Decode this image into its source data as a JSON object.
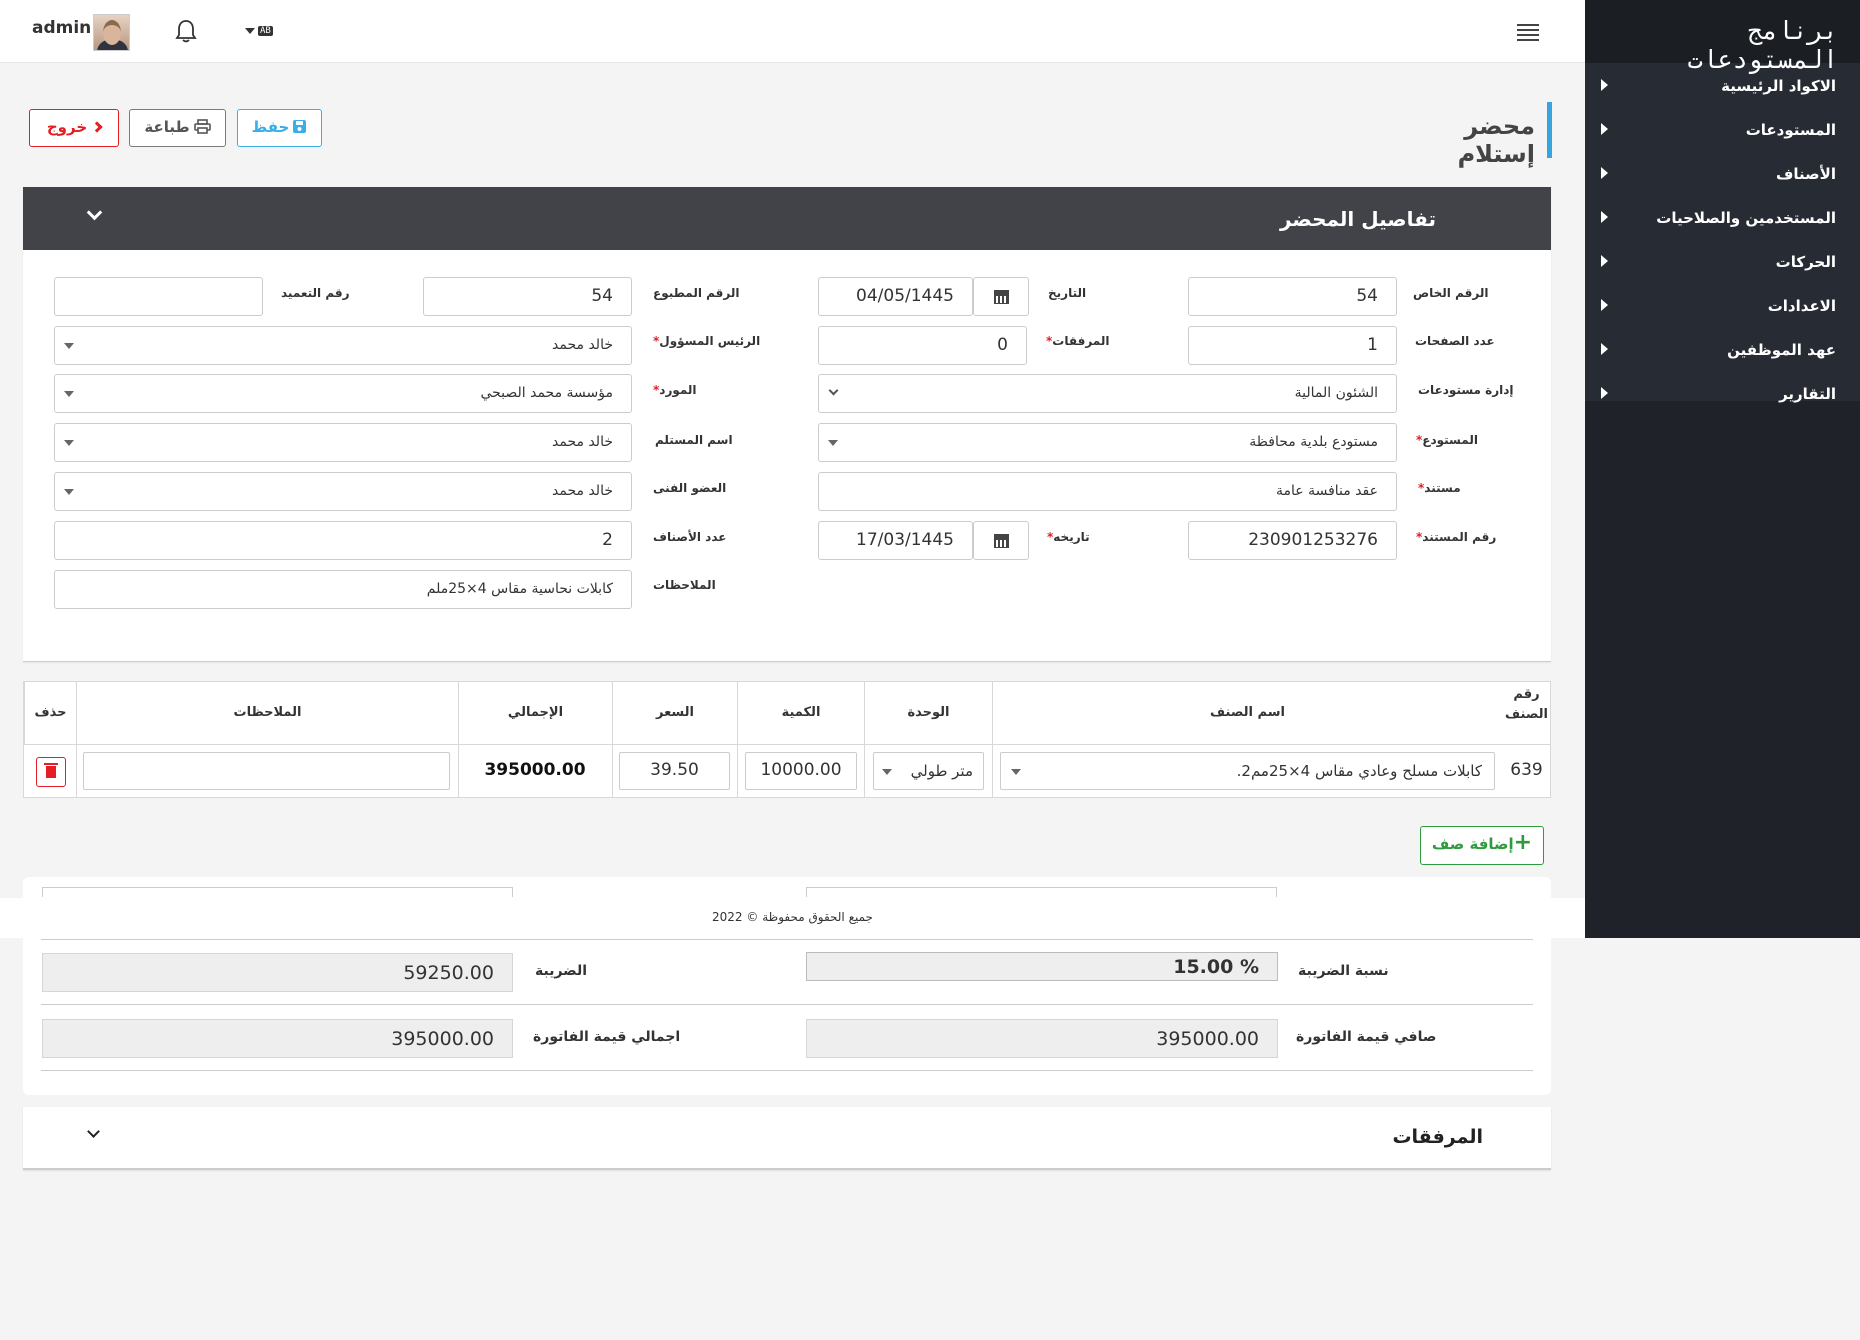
{
  "app": {
    "title": "برنامج المستودعات"
  },
  "sidebar": {
    "items": [
      {
        "label": "الاكواد الرئيسية"
      },
      {
        "label": "المستودعات"
      },
      {
        "label": "الأصناف"
      },
      {
        "label": "المستخدمين والصلاحيات"
      },
      {
        "label": "الحركات"
      },
      {
        "label": "الاعدادات"
      },
      {
        "label": "عهد الموظفين"
      },
      {
        "label": "التقارير"
      }
    ]
  },
  "topbar": {
    "user_name": "admin",
    "language_badge": "AB"
  },
  "page": {
    "title": "محضر إستلام"
  },
  "actions": {
    "save_label": "حفظ",
    "print_label": "طباعة",
    "exit_label": "خروج"
  },
  "details": {
    "header": "تفاصيل المحضر",
    "private_number": {
      "label": "الرقم الخاص",
      "value": "54"
    },
    "date": {
      "label": "التاريخ",
      "value": "04/05/1445"
    },
    "printed_number": {
      "label": "الرقم المطبوع",
      "value": "54"
    },
    "assignment_number": {
      "label": "رقم التعميد",
      "value": ""
    },
    "pages_count": {
      "label": "عدد الصفحات",
      "value": "1"
    },
    "attachments_count": {
      "label": "المرفقات",
      "value": "0"
    },
    "responsible_head": {
      "label": "الرئيس المسؤول",
      "value": "خالد محمد"
    },
    "warehouse_management": {
      "label": "إدارة مستودعات",
      "value": "الشئون المالية"
    },
    "supplier": {
      "label": "المورد",
      "value": "مؤسسة محمد الصبحي"
    },
    "warehouse": {
      "label": "المستودع",
      "value": "مستودع بلدية محافظة"
    },
    "receiver_name": {
      "label": "اسم المستلم",
      "value": "خالد محمد"
    },
    "document": {
      "label": "مستند",
      "value": "عقد منافسة عامة"
    },
    "technical_member": {
      "label": "العضو الفنى",
      "value": "خالد محمد"
    },
    "document_number": {
      "label": "رقم المستند",
      "value": "230901253276"
    },
    "document_date": {
      "label": "تاريخه",
      "value": "17/03/1445"
    },
    "items_count": {
      "label": "عدد الأصناف",
      "value": "2"
    },
    "notes": {
      "label": "الملاحظات",
      "value": "كابلات نحاسية مقاس 4×25ملم"
    },
    "required_mark": "*"
  },
  "items_table": {
    "headers": {
      "item_number": "رقم الصنف",
      "item_name": "اسم الصنف",
      "unit": "الوحدة",
      "quantity": "الكمية",
      "price": "السعر",
      "total": "الإجمالي",
      "notes": "الملاحظات",
      "delete": "حذف"
    },
    "rows": [
      {
        "item_number": "639",
        "item_name": "كابلات مسلح وعادي مقاس 4×25مم2.",
        "unit": "متر طولي",
        "quantity": "10000.00",
        "price": "39.50",
        "total": "395000.00",
        "notes": ""
      }
    ],
    "add_row_label": "إضافة صف"
  },
  "footer": {
    "copyright": "جميع الحقوق محفوظة © 2022"
  },
  "totals": {
    "tax_rate": {
      "label": "نسبة الضريبة",
      "value": "% 15.00"
    },
    "tax": {
      "label": "الضريبة",
      "value": "59250.00"
    },
    "net_invoice": {
      "label": "صافي قيمة الفاتورة",
      "value": "395000.00"
    },
    "gross_invoice": {
      "label": "اجمالي قيمة الفاتورة",
      "value": "395000.00"
    }
  },
  "attachments_section": {
    "title": "المرفقات"
  },
  "colors": {
    "accent": "#37a4e0",
    "danger": "#e31e24",
    "success": "#2e9b3f",
    "sidebar_bg": "#272b33",
    "card_header_bg": "#414349"
  }
}
